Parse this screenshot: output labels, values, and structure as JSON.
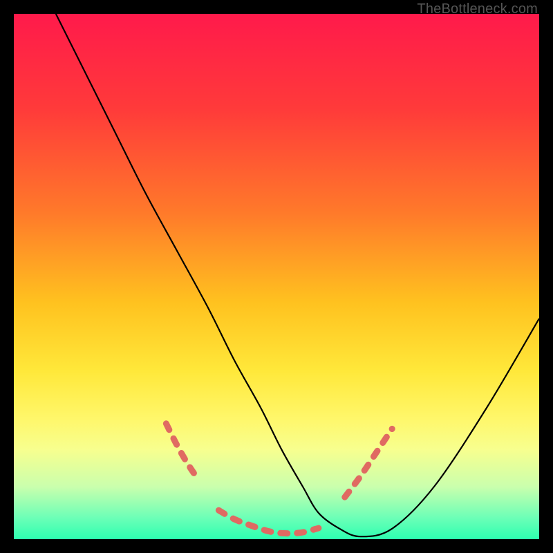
{
  "watermark": "TheBottleneck.com",
  "chart_data": {
    "type": "line",
    "title": "",
    "xlabel": "",
    "ylabel": "",
    "xlim": [
      0,
      100
    ],
    "ylim": [
      0,
      100
    ],
    "grid": false,
    "legend": false,
    "gradient_stops": [
      {
        "pct": 0,
        "color": "#ff1a4b"
      },
      {
        "pct": 18,
        "color": "#ff3a3a"
      },
      {
        "pct": 38,
        "color": "#ff7a2a"
      },
      {
        "pct": 55,
        "color": "#ffc21f"
      },
      {
        "pct": 68,
        "color": "#ffe83a"
      },
      {
        "pct": 77,
        "color": "#fff76a"
      },
      {
        "pct": 83,
        "color": "#f7ff8f"
      },
      {
        "pct": 90,
        "color": "#caffad"
      },
      {
        "pct": 96,
        "color": "#6bffb7"
      },
      {
        "pct": 100,
        "color": "#2dffb0"
      }
    ],
    "series": [
      {
        "name": "bottleneck-curve",
        "x": [
          8,
          13,
          19,
          25,
          31,
          37,
          42,
          47,
          51,
          55,
          58,
          62,
          66,
          72,
          80,
          90,
          100
        ],
        "y": [
          100,
          90,
          78,
          66,
          55,
          44,
          34,
          25,
          17,
          10,
          5,
          2,
          0.5,
          2,
          10,
          25,
          42
        ],
        "color": "#000000",
        "width": 2.2
      }
    ],
    "highlight_segments": [
      {
        "name": "left-shoulder",
        "x": [
          29,
          31,
          33,
          35
        ],
        "y": [
          22,
          18,
          14.5,
          11.5
        ],
        "color": "#e06a62",
        "width": 9
      },
      {
        "name": "valley-floor",
        "x": [
          39,
          42,
          46,
          49,
          52,
          55,
          58
        ],
        "y": [
          5.5,
          3.8,
          2.3,
          1.4,
          1.1,
          1.3,
          2.1
        ],
        "color": "#e06a62",
        "width": 9
      },
      {
        "name": "right-shoulder",
        "x": [
          63,
          66,
          69,
          72
        ],
        "y": [
          8,
          12,
          16.5,
          21
        ],
        "color": "#e06a62",
        "width": 9
      }
    ]
  }
}
